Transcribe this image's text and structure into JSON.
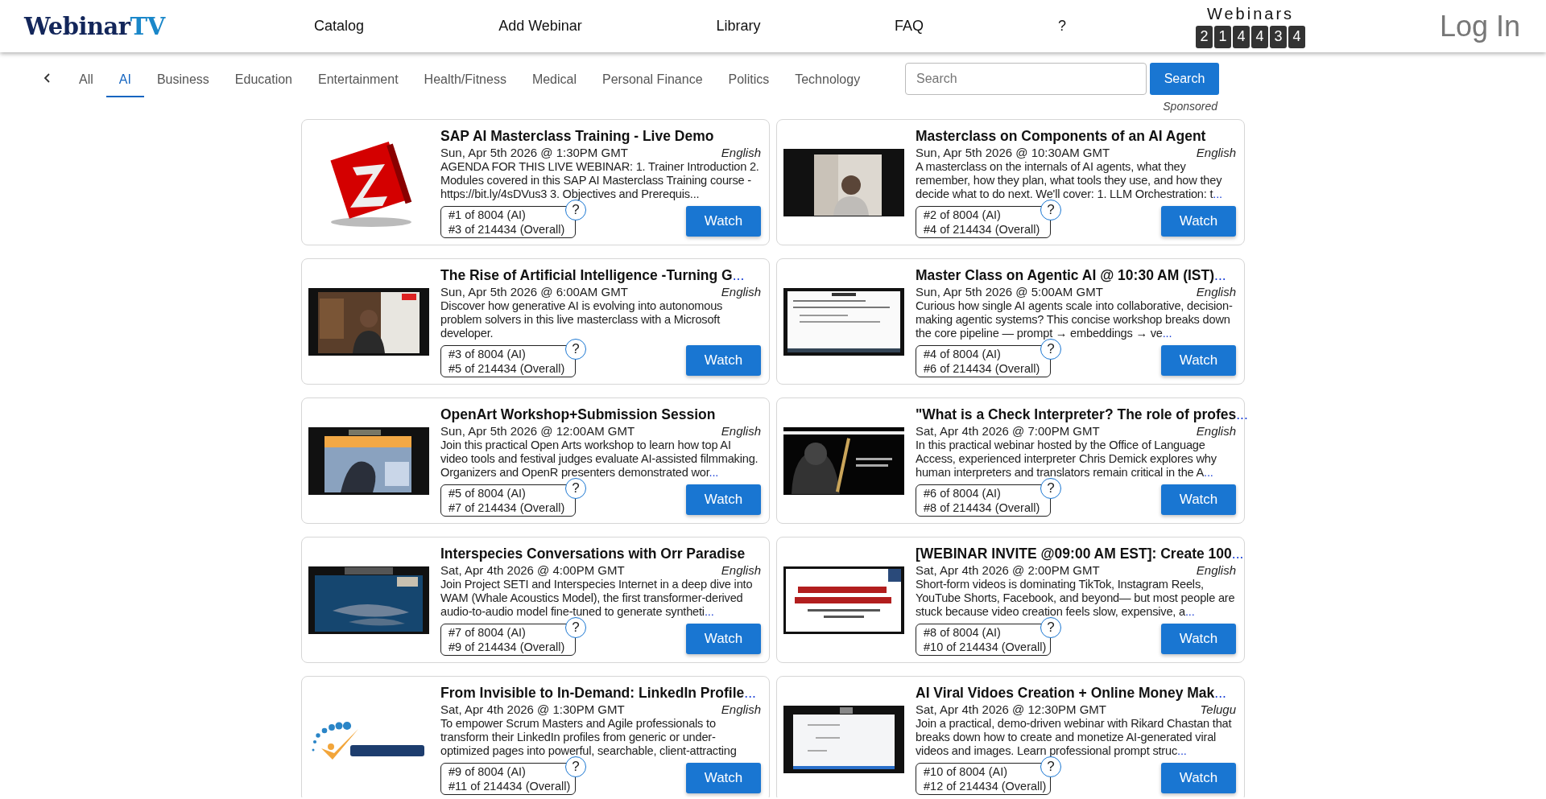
{
  "header": {
    "logo": {
      "name": "Webinar",
      "suffix": "TV"
    },
    "nav": [
      {
        "label": "Catalog"
      },
      {
        "label": "Add Webinar"
      },
      {
        "label": "Library"
      },
      {
        "label": "FAQ"
      },
      {
        "label": "?"
      }
    ],
    "counter": {
      "label": "Webinars",
      "digits": [
        "2",
        "1",
        "4",
        "4",
        "3",
        "4"
      ]
    },
    "login": "Log In"
  },
  "categories": [
    {
      "label": "All",
      "selected": false
    },
    {
      "label": "AI",
      "selected": true
    },
    {
      "label": "Business",
      "selected": false
    },
    {
      "label": "Education",
      "selected": false
    },
    {
      "label": "Entertainment",
      "selected": false
    },
    {
      "label": "Health/Fitness",
      "selected": false
    },
    {
      "label": "Medical",
      "selected": false
    },
    {
      "label": "Personal Finance",
      "selected": false
    },
    {
      "label": "Politics",
      "selected": false
    },
    {
      "label": "Technology",
      "selected": false
    }
  ],
  "search": {
    "placeholder": "Search",
    "button": "Search"
  },
  "sponsored": "Sponsored",
  "webinars": [
    {
      "title": "SAP AI Masterclass Training - Live Demo",
      "date": "Sun, Apr 5th 2026 @ 1:30PM GMT",
      "language": "English",
      "description": "AGENDA FOR THIS LIVE WEBINAR: 1. Trainer Introduction 2. Modules covered in this SAP AI Masterclass Training course - https://bit.ly/4sDVus3 3. Objectives and Prerequis...",
      "rank_category": "#1 of 8004 (AI)",
      "rank_overall": "#3 of 214434 (Overall)",
      "help": "?",
      "button": "Watch"
    },
    {
      "title": "Masterclass on Components of an AI Agent",
      "date": "Sun, Apr 5th 2026 @ 10:30AM GMT",
      "language": "English",
      "description": "A masterclass on the internals of AI agents, what they remember, how they plan, what tools they use, and how they decide what to do next. We'll cover: 1. LLM Orchestration: t",
      "description_more": "...",
      "rank_category": "#2 of 8004 (AI)",
      "rank_overall": "#4 of 214434 (Overall)",
      "help": "?",
      "button": "Watch"
    },
    {
      "title": "The Rise of Artificial Intelligence -Turning G",
      "title_more": "...",
      "date": "Sun, Apr 5th 2026 @ 6:00AM GMT",
      "language": "English",
      "description": "Discover how generative AI is evolving into autonomous problem solvers in this live masterclass with a Microsoft developer.",
      "rank_category": "#3 of 8004 (AI)",
      "rank_overall": "#5 of 214434 (Overall)",
      "help": "?",
      "button": "Watch"
    },
    {
      "title": "Master Class on Agentic AI @ 10:30 AM (IST)",
      "title_more": "...",
      "date": "Sun, Apr 5th 2026 @ 5:00AM GMT",
      "language": "English",
      "description": "Curious how single AI agents scale into collaborative, decision-making agentic systems? This concise workshop breaks down the core pipeline — prompt → embeddings → ve",
      "description_more": "...",
      "rank_category": "#4 of 8004 (AI)",
      "rank_overall": "#6 of 214434 (Overall)",
      "help": "?",
      "button": "Watch"
    },
    {
      "title": "OpenArt Workshop+Submission Session",
      "date": "Sun, Apr 5th 2026 @ 12:00AM GMT",
      "language": "English",
      "description": "Join this practical Open Arts workshop to learn how top AI video tools and festival judges evaluate AI-assisted filmmaking. Organizers and OpenR presenters demonstrated wor",
      "description_more": "...",
      "rank_category": "#5 of 8004 (AI)",
      "rank_overall": "#7 of 214434 (Overall)",
      "help": "?",
      "button": "Watch"
    },
    {
      "title": "\"What is a Check Interpreter? The role of profes",
      "title_more": "...",
      "date": "Sat, Apr 4th 2026 @ 7:00PM GMT",
      "language": "English",
      "description": "In this practical webinar hosted by the Office of Language Access, experienced interpreter Chris Demick explores why human interpreters and translators remain critical in the A",
      "description_more": "...",
      "rank_category": "#6 of 8004 (AI)",
      "rank_overall": "#8 of 214434 (Overall)",
      "help": "?",
      "button": "Watch"
    },
    {
      "title": "Interspecies Conversations with Orr Paradise",
      "date": "Sat, Apr 4th 2026 @ 4:00PM GMT",
      "language": "English",
      "description": "Join Project SETI and Interspecies Internet in a deep dive into WAM (Whale Acoustics Model), the first transformer-derived audio-to-audio model fine-tuned to generate syntheti",
      "description_more": "...",
      "rank_category": "#7 of 8004 (AI)",
      "rank_overall": "#9 of 214434 (Overall)",
      "help": "?",
      "button": "Watch"
    },
    {
      "title": "[WEBINAR INVITE @09:00 AM EST]: Create 100",
      "title_more": "...",
      "date": "Sat, Apr 4th 2026 @ 2:00PM GMT",
      "language": "English",
      "description": "Short-form videos is dominating TikTok, Instagram Reels, YouTube Shorts, Facebook, and beyond— but most people are stuck because video creation feels slow, expensive, a",
      "description_more": "...",
      "rank_category": "#8 of 8004 (AI)",
      "rank_overall": "#10 of 214434 (Overall)",
      "help": "?",
      "button": "Watch"
    },
    {
      "title": "From Invisible to In-Demand: LinkedIn Profile",
      "title_more": "...",
      "date": "Sat, Apr 4th 2026 @ 1:30PM GMT",
      "language": "English",
      "description": "To empower Scrum Masters and Agile professionals to transform their LinkedIn profiles from generic or under-optimized pages into powerful, searchable, client-attracting",
      "rank_category": "#9 of 8004 (AI)",
      "rank_overall": "#11 of 214434 (Overall)",
      "help": "?",
      "button": "Watch"
    },
    {
      "title": "AI Viral Vidoes Creation + Online Money Mak",
      "title_more": "...",
      "date": "Sat, Apr 4th 2026 @ 12:30PM GMT",
      "language": "Telugu",
      "description": "Join a practical, demo-driven webinar with Rikard Chastan that breaks down how to create and monetize AI-generated viral videos and images. Learn professional prompt struc",
      "description_more": "...",
      "rank_category": "#10 of 8004 (AI)",
      "rank_overall": "#12 of 214434 (Overall)",
      "help": "?",
      "button": "Watch"
    }
  ]
}
